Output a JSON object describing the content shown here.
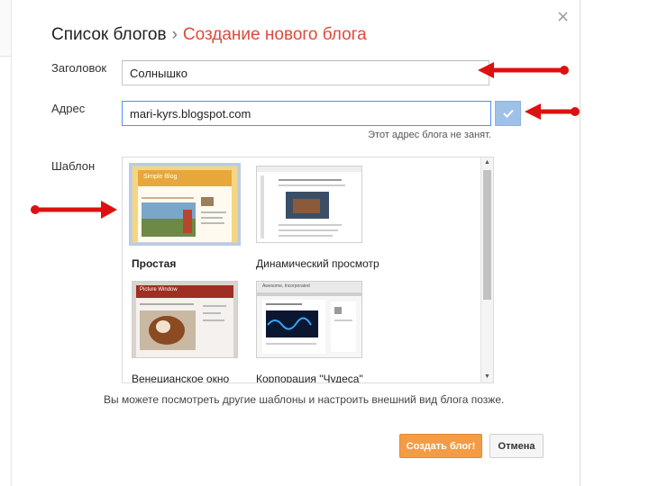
{
  "dialog": {
    "close_glyph": "×",
    "breadcrumb": {
      "first": "Список блогов",
      "separator": "›",
      "current": "Создание нового блога"
    }
  },
  "form": {
    "title_label": "Заголовок",
    "title_value": "Солнышко",
    "address_label": "Адрес",
    "address_value": "mari-kyrs.blogspot.com",
    "address_status": "Этот адрес блога не занят.",
    "template_label": "Шаблон"
  },
  "templates": [
    {
      "name": "Простая",
      "selected": true,
      "thumb_title": "Simple Blog"
    },
    {
      "name": "Динамический просмотр",
      "selected": false
    },
    {
      "name": "Венецианское окно",
      "selected": false,
      "thumb_title": "Picture Window"
    },
    {
      "name": "Корпорация \"Чудеса\"",
      "selected": false,
      "thumb_title": "Awesome, Incorporated"
    }
  ],
  "hint": "Вы можете посмотреть другие шаблоны и настроить внешний вид блога позже.",
  "buttons": {
    "create_label": "Создать блог!",
    "cancel_label": "Отмена"
  },
  "colors": {
    "accent_red": "#dd4b39",
    "create_button": "#f39c45",
    "check_button": "#9fc1e8",
    "annotation_arrow": "#dd1111"
  },
  "icons": [
    "close-icon",
    "checkmark-icon",
    "scroll-up-icon",
    "scroll-down-icon",
    "arrow-annotation"
  ]
}
